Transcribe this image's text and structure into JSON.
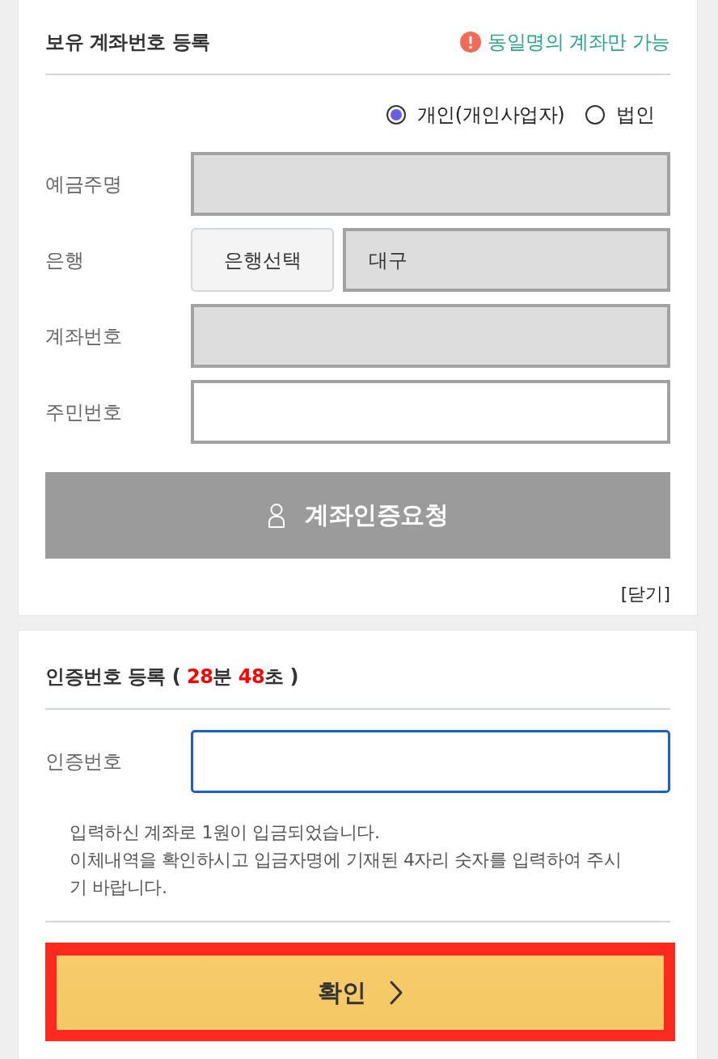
{
  "account_section": {
    "title": "보유 계좌번호 등록",
    "notice": "동일명의 계좌만 가능",
    "account_types": [
      {
        "label": "개인(개인사업자)",
        "selected": true
      },
      {
        "label": "법인",
        "selected": false
      }
    ],
    "fields": [
      {
        "kind": "text",
        "label": "예금주명",
        "readonly": true
      },
      {
        "kind": "bank",
        "label": "은행",
        "button": "은행선택",
        "value": "대구",
        "readonly": true
      },
      {
        "kind": "text",
        "label": "계좌번호",
        "readonly": true
      },
      {
        "kind": "text",
        "label": "주민번호",
        "readonly": false
      }
    ],
    "request_button": "계좌인증요청",
    "close_link": "[닫기]"
  },
  "verification_section": {
    "title_parts": [
      {
        "kind": "plain",
        "text": "인증번호 등록 ( "
      },
      {
        "kind": "number",
        "text": "28"
      },
      {
        "kind": "plain",
        "text": "분 "
      },
      {
        "kind": "number",
        "text": "48"
      },
      {
        "kind": "plain",
        "text": "초 )"
      }
    ],
    "field": {
      "label": "인증번호",
      "focused": true
    },
    "message_lines": [
      "입력하신 계좌로 1원이 입금되었습니다.",
      "이체내역을 확인하시고 입금자명에 기재된 4자리 숫자를 입력하여 주시기 바랍니다."
    ],
    "confirm_button": {
      "label": "확인",
      "highlighted": true
    }
  }
}
